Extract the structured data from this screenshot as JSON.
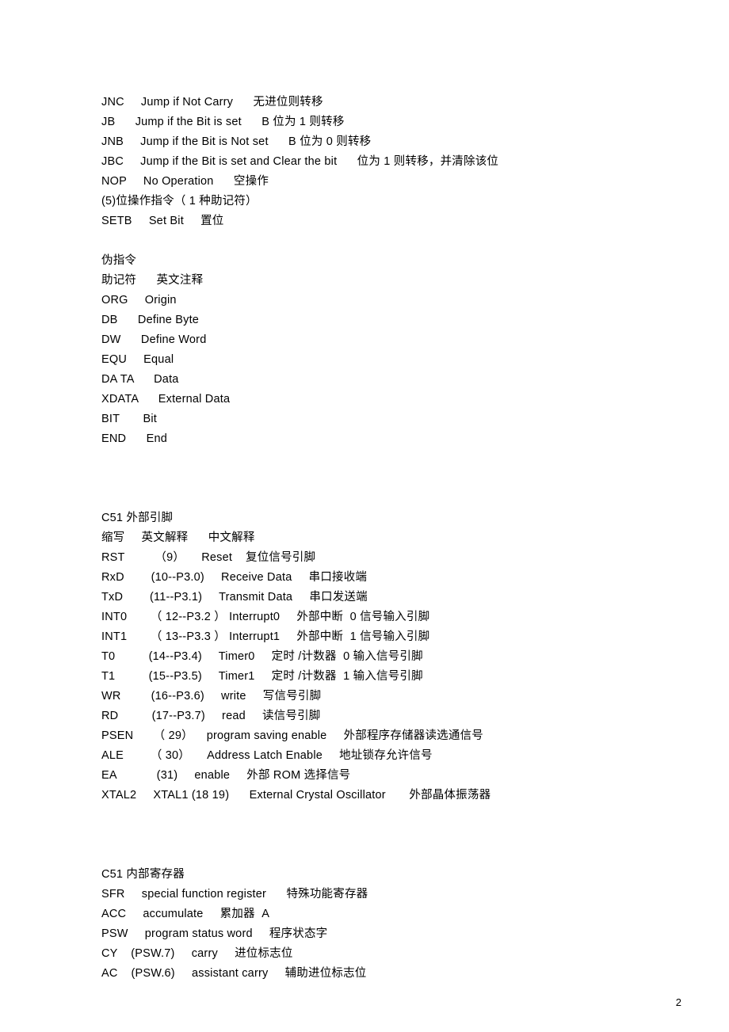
{
  "lines": [
    "JNC     Jump if Not Carry      无进位则转移",
    "JB      Jump if the Bit is set      B 位为 1 则转移",
    "JNB     Jump if the Bit is Not set      B 位为 0 则转移",
    "JBC     Jump if the Bit is set and Clear the bit      位为 1 则转移，并清除该位",
    "NOP     No Operation      空操作",
    "(5)位操作指令（ 1 种助记符）",
    "SETB     Set Bit     置位",
    "",
    "伪指令",
    "助记符      英文注释",
    "ORG     Origin",
    "DB      Define Byte",
    "DW      Define Word",
    "EQU     Equal",
    "DA TA      Data",
    "XDATA      External Data",
    "BIT       Bit",
    "END      End",
    "",
    "",
    "",
    "C51 外部引脚",
    "缩写     英文解释      中文解释",
    "RST         （9）     Reset    复位信号引脚",
    "RxD        (10--P3.0)     Receive Data     串口接收端",
    "TxD        (11--P3.1)     Transmit Data     串口发送端",
    "INT0       （ 12--P3.2 ） Interrupt0     外部中断  0 信号输入引脚",
    "INT1       （ 13--P3.3 ） Interrupt1     外部中断  1 信号输入引脚",
    "T0          (14--P3.4)     Timer0     定时 /计数器  0 输入信号引脚",
    "T1          (15--P3.5)     Timer1     定时 /计数器  1 输入信号引脚",
    "WR         (16--P3.6)     write     写信号引脚",
    "RD          (17--P3.7)     read     读信号引脚",
    "PSEN      （ 29）    program saving enable     外部程序存储器读选通信号",
    "ALE        （ 30）     Address Latch Enable     地址锁存允许信号",
    "EA            (31)     enable     外部 ROM 选择信号",
    "XTAL2     XTAL1 (18 19)      External Crystal Oscillator       外部晶体振荡器",
    "",
    "",
    "",
    "C51 内部寄存器",
    "SFR     special function register      特殊功能寄存器",
    "ACC     accumulate     累加器  A",
    "PSW     program status word     程序状态字",
    "CY    (PSW.7)     carry     进位标志位",
    "AC    (PSW.6)     assistant carry     辅助进位标志位"
  ],
  "page_number": "2"
}
